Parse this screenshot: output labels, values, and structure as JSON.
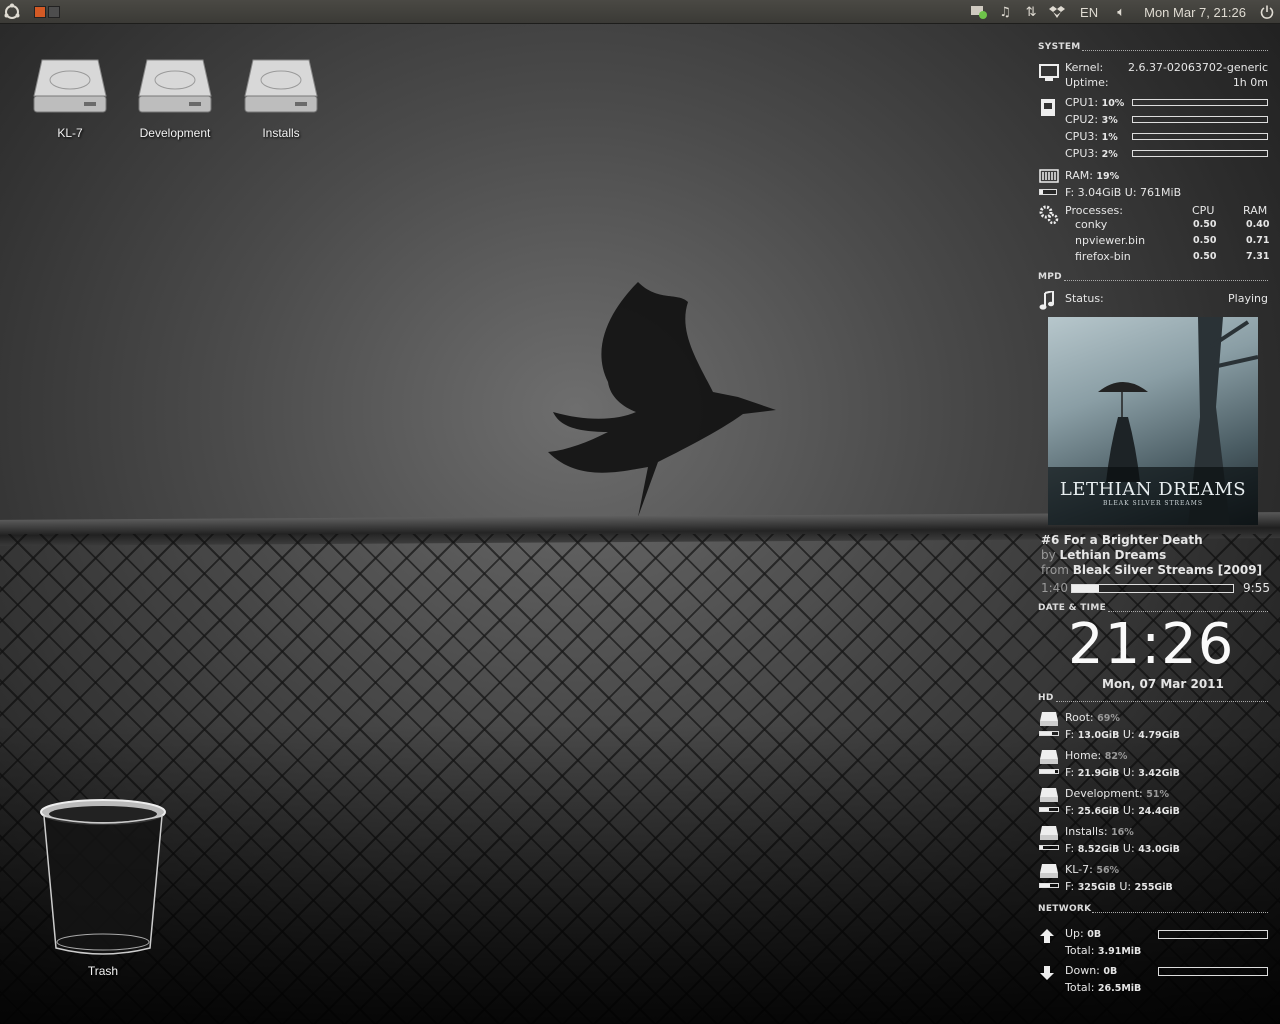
{
  "top_panel": {
    "language": "EN",
    "clock": "Mon Mar  7, 21:26"
  },
  "desktop_icons": [
    {
      "label": "KL-7"
    },
    {
      "label": "Development"
    },
    {
      "label": "Installs"
    },
    {
      "label": "Trash"
    }
  ],
  "conky": {
    "system": {
      "title": "SYSTEM",
      "kernel_label": "Kernel:",
      "kernel_value": "2.6.37-02063702-generic",
      "uptime_label": "Uptime:",
      "uptime_value": "1h 0m",
      "cpus": [
        {
          "label": "CPU1:",
          "value": "10%"
        },
        {
          "label": "CPU2:",
          "value": "3%"
        },
        {
          "label": "CPU3:",
          "value": "1%"
        },
        {
          "label": "CPU3:",
          "value": "2%"
        }
      ],
      "ram_label": "RAM:",
      "ram_value": "19%",
      "ram_fill": 0.19,
      "ram_detail": "F: 3.04GiB U: 761MiB",
      "processes_label": "Processes:",
      "proc_col_cpu": "CPU",
      "proc_col_ram": "RAM",
      "processes": [
        {
          "name": "conky",
          "cpu": "0.50",
          "ram": "0.40"
        },
        {
          "name": "npviewer.bin",
          "cpu": "0.50",
          "ram": "0.71"
        },
        {
          "name": "firefox-bin",
          "cpu": "0.50",
          "ram": "7.31"
        }
      ]
    },
    "mpd": {
      "title": "MPD",
      "status_label": "Status:",
      "status_value": "Playing",
      "cover_text": "LETHIAN DREAMS",
      "cover_subtext": "BLEAK SILVER STREAMS",
      "track": "#6 For a Brighter Death",
      "by_label": "by",
      "artist": "Lethian Dreams",
      "from_label": "from",
      "album": "Bleak Silver Streams [2009]",
      "elapsed": "1:40",
      "total": "9:55",
      "progress": 0.17
    },
    "datetime": {
      "title": "DATE & TIME",
      "time": "21:26",
      "date": "Mon, 07 Mar 2011"
    },
    "hd": {
      "title": "HD",
      "disks": [
        {
          "name": "Root:",
          "pct": "69%",
          "fill": 0.69,
          "free": "13.0GiB",
          "used": "4.79GiB"
        },
        {
          "name": "Home:",
          "pct": "82%",
          "fill": 0.82,
          "free": "21.9GiB",
          "used": "3.42GiB"
        },
        {
          "name": "Development:",
          "pct": "51%",
          "fill": 0.51,
          "free": "25.6GiB",
          "used": "24.4GiB"
        },
        {
          "name": "Installs:",
          "pct": "16%",
          "fill": 0.16,
          "free": "8.52GiB",
          "used": "43.0GiB"
        },
        {
          "name": "KL-7:",
          "pct": "56%",
          "fill": 0.56,
          "free": "325GiB",
          "used": "255GiB"
        }
      ],
      "free_label": "F:",
      "used_label": "U:"
    },
    "network": {
      "title": "NETWORK",
      "up_label": "Up:",
      "up_value": "0B",
      "up_total_label": "Total:",
      "up_total": "3.91MiB",
      "down_label": "Down:",
      "down_value": "0B",
      "down_total_label": "Total:",
      "down_total": "26.5MiB"
    }
  }
}
